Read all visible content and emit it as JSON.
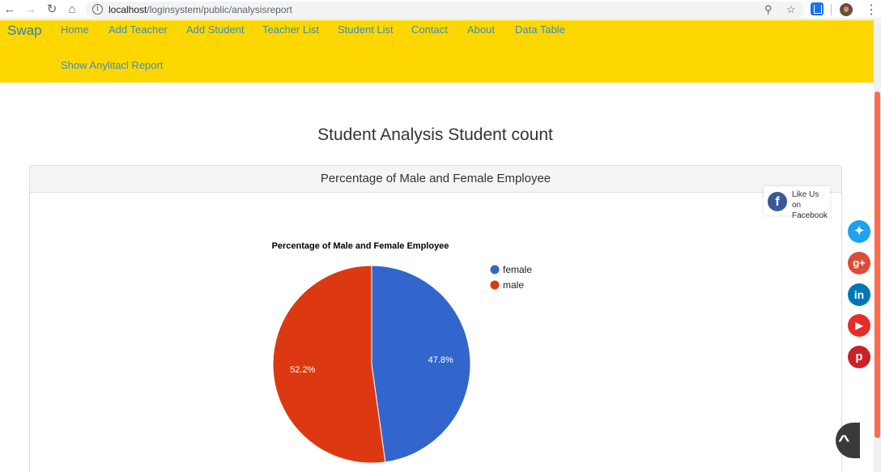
{
  "browser": {
    "url_host": "localhost",
    "url_path": "/loginsystem/public/analysisreport"
  },
  "navbar": {
    "brand": "Swap",
    "links": [
      "Home",
      "Add Teacher",
      "Add Student",
      "Teacher List",
      "Student List",
      "Contact",
      "About",
      "Data Table",
      "Show Anylitacl Report"
    ]
  },
  "page": {
    "title": "Student Analysis Student count"
  },
  "panel": {
    "heading": "Percentage of Male and Female Employee"
  },
  "chart_data": {
    "type": "pie",
    "title": "Percentage of Male and Female Employee",
    "categories": [
      "female",
      "male"
    ],
    "values": [
      47.8,
      52.2
    ],
    "labels": [
      "47.8%",
      "52.2%"
    ],
    "colors": [
      "#3366cc",
      "#dc3912"
    ],
    "legend_position": "right"
  },
  "social": {
    "facebook_text": "Like Us on Facebook",
    "icons": [
      "twitter-icon",
      "google-plus-icon",
      "linkedin-icon",
      "youtube-icon",
      "pinterest-icon"
    ],
    "colors": {
      "facebook": "#3b5998",
      "twitter": "#1da1f2",
      "google": "#dd4b39",
      "linkedin": "#0077b5",
      "youtube": "#e52d27",
      "pinterest": "#cb2027"
    }
  }
}
